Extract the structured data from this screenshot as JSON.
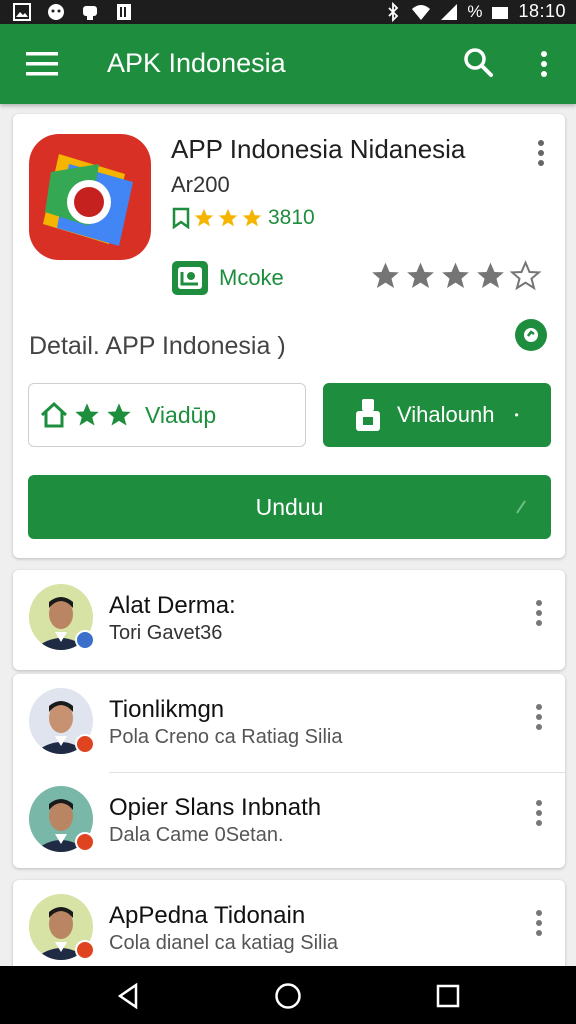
{
  "status_bar": {
    "time": "18:10",
    "icons": [
      "image-icon",
      "face-icon",
      "voicemail-icon",
      "clipboard-icon",
      "bluetooth-icon",
      "wifi-icon",
      "signal-icon",
      "battery-icon"
    ],
    "battery_label": "%"
  },
  "app_bar": {
    "title": "APK Indonesia",
    "icons": [
      "menu-icon",
      "search-icon",
      "more-vert-icon"
    ]
  },
  "app": {
    "name": "APP Indonesia Nidanesia",
    "version": "Ar200",
    "rating_text": "3810",
    "make_label": "Mcoke",
    "detail_text": "Detail. APP Indonesia )",
    "rate_button_label": "Viadūp",
    "install_button_label": "Vihalounh",
    "unduh_label": "Unduu"
  },
  "reviews": [
    {
      "name": "Alat Derma:",
      "subtitle": "Tori Gavet36",
      "badge_color": "#3a6fcb"
    },
    {
      "name": "Tionlikmgn",
      "subtitle": "Pola Creno ca Ratiag Silia",
      "badge_color": "#e0431f"
    },
    {
      "name": "Opier Slans Inbnath",
      "subtitle": "Dala Came 0Setan.",
      "badge_color": "#e0431f"
    },
    {
      "name": "ApPedna Tidonain",
      "subtitle": "Cola dianel ca katiag Silia",
      "badge_color": "#e0431f"
    }
  ],
  "colors": {
    "primary_green": "#1e8e3e",
    "star_gold": "#f4b400",
    "star_gray": "#757575",
    "app_icon_red": "#d93025"
  },
  "nav_bar": {
    "icons": [
      "back-icon",
      "home-icon",
      "recents-icon"
    ]
  }
}
